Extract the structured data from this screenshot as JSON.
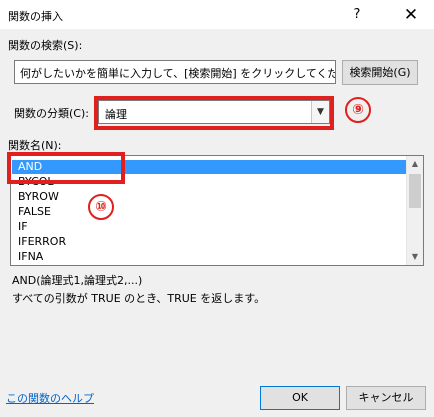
{
  "dialog": {
    "title": "関数の挿入",
    "help_button": "?",
    "close_button": "✕"
  },
  "search": {
    "label": "関数の検索(S):",
    "input_value": "何がしたいかを簡単に入力して、[検索開始] をクリックしてください。",
    "button_label": "検索開始(G)"
  },
  "category": {
    "label": "関数の分類(C):",
    "selected": "論理",
    "arrow_icon": "chevron-down-icon"
  },
  "function_list": {
    "label": "関数名(N):",
    "items": [
      "AND",
      "BYCOL",
      "BYROW",
      "FALSE",
      "IF",
      "IFERROR",
      "IFNA"
    ],
    "selected_index": 0
  },
  "description": {
    "syntax": "AND(論理式1,論理式2,...)",
    "text": "すべての引数が TRUE のとき、TRUE を返します。"
  },
  "footer": {
    "help_link": "この関数のヘルプ",
    "ok_label": "OK",
    "cancel_label": "キャンセル"
  },
  "annotations": {
    "marker_9": "⑨",
    "marker_10": "⑩",
    "highlight_color": "#e0201e"
  },
  "colors": {
    "selection": "#3399ff",
    "link": "#0066cc"
  }
}
